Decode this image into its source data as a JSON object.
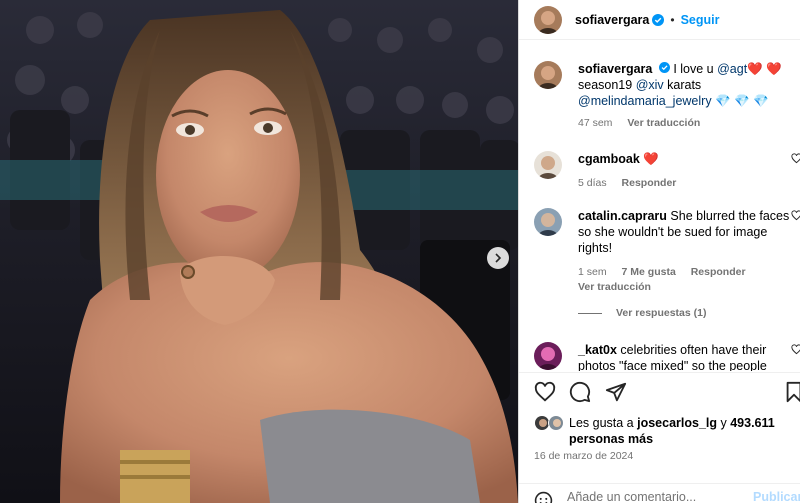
{
  "post": {
    "author": "sofiavergara",
    "follow_label": "Seguir",
    "dot": "•",
    "caption": {
      "author": "sofiavergara",
      "text_1": "I love u ",
      "mention_1": "@agt",
      "hearts": "❤️ ❤️",
      "text_2": "season19 ",
      "mention_2": "@xiv",
      "text_3": " karats",
      "mention_3": "@melindamaria_jewelry",
      "gems": " 💎 💎 💎",
      "time": "47 sem",
      "translate": "Ver traducción"
    }
  },
  "comments": [
    {
      "user": "cgamboak",
      "text": "❤️",
      "time": "5 días",
      "reply": "Responder"
    },
    {
      "user": "catalin.capraru",
      "text": "She blurred the faces so she wouldn't be sued for image rights!",
      "time": "1 sem",
      "likes": "7 Me gusta",
      "reply": "Responder",
      "translate": "Ver traducción",
      "view_replies": "Ver respuestas (1)"
    },
    {
      "user": "_kat0x",
      "text": "celebrities often have their photos \"face mixed\" so the people"
    }
  ],
  "likes": {
    "prefix": "Les gusta a ",
    "user": "josecarlos_lg",
    "conj": " y ",
    "count": "493.611",
    "suffix": "personas más"
  },
  "date": "16 de marzo de 2024",
  "add_comment": {
    "placeholder": "Añade un comentario...",
    "post_label": "Publicar"
  },
  "colors": {
    "accent": "#0095f6",
    "verified": "#0095f6",
    "heart": "#ff3040",
    "mention": "#00376b",
    "muted": "#737373"
  },
  "icons": [
    "verified-icon",
    "heart-icon",
    "comment-icon",
    "share-icon",
    "bookmark-icon",
    "emoji-icon",
    "chevron-right-icon"
  ]
}
